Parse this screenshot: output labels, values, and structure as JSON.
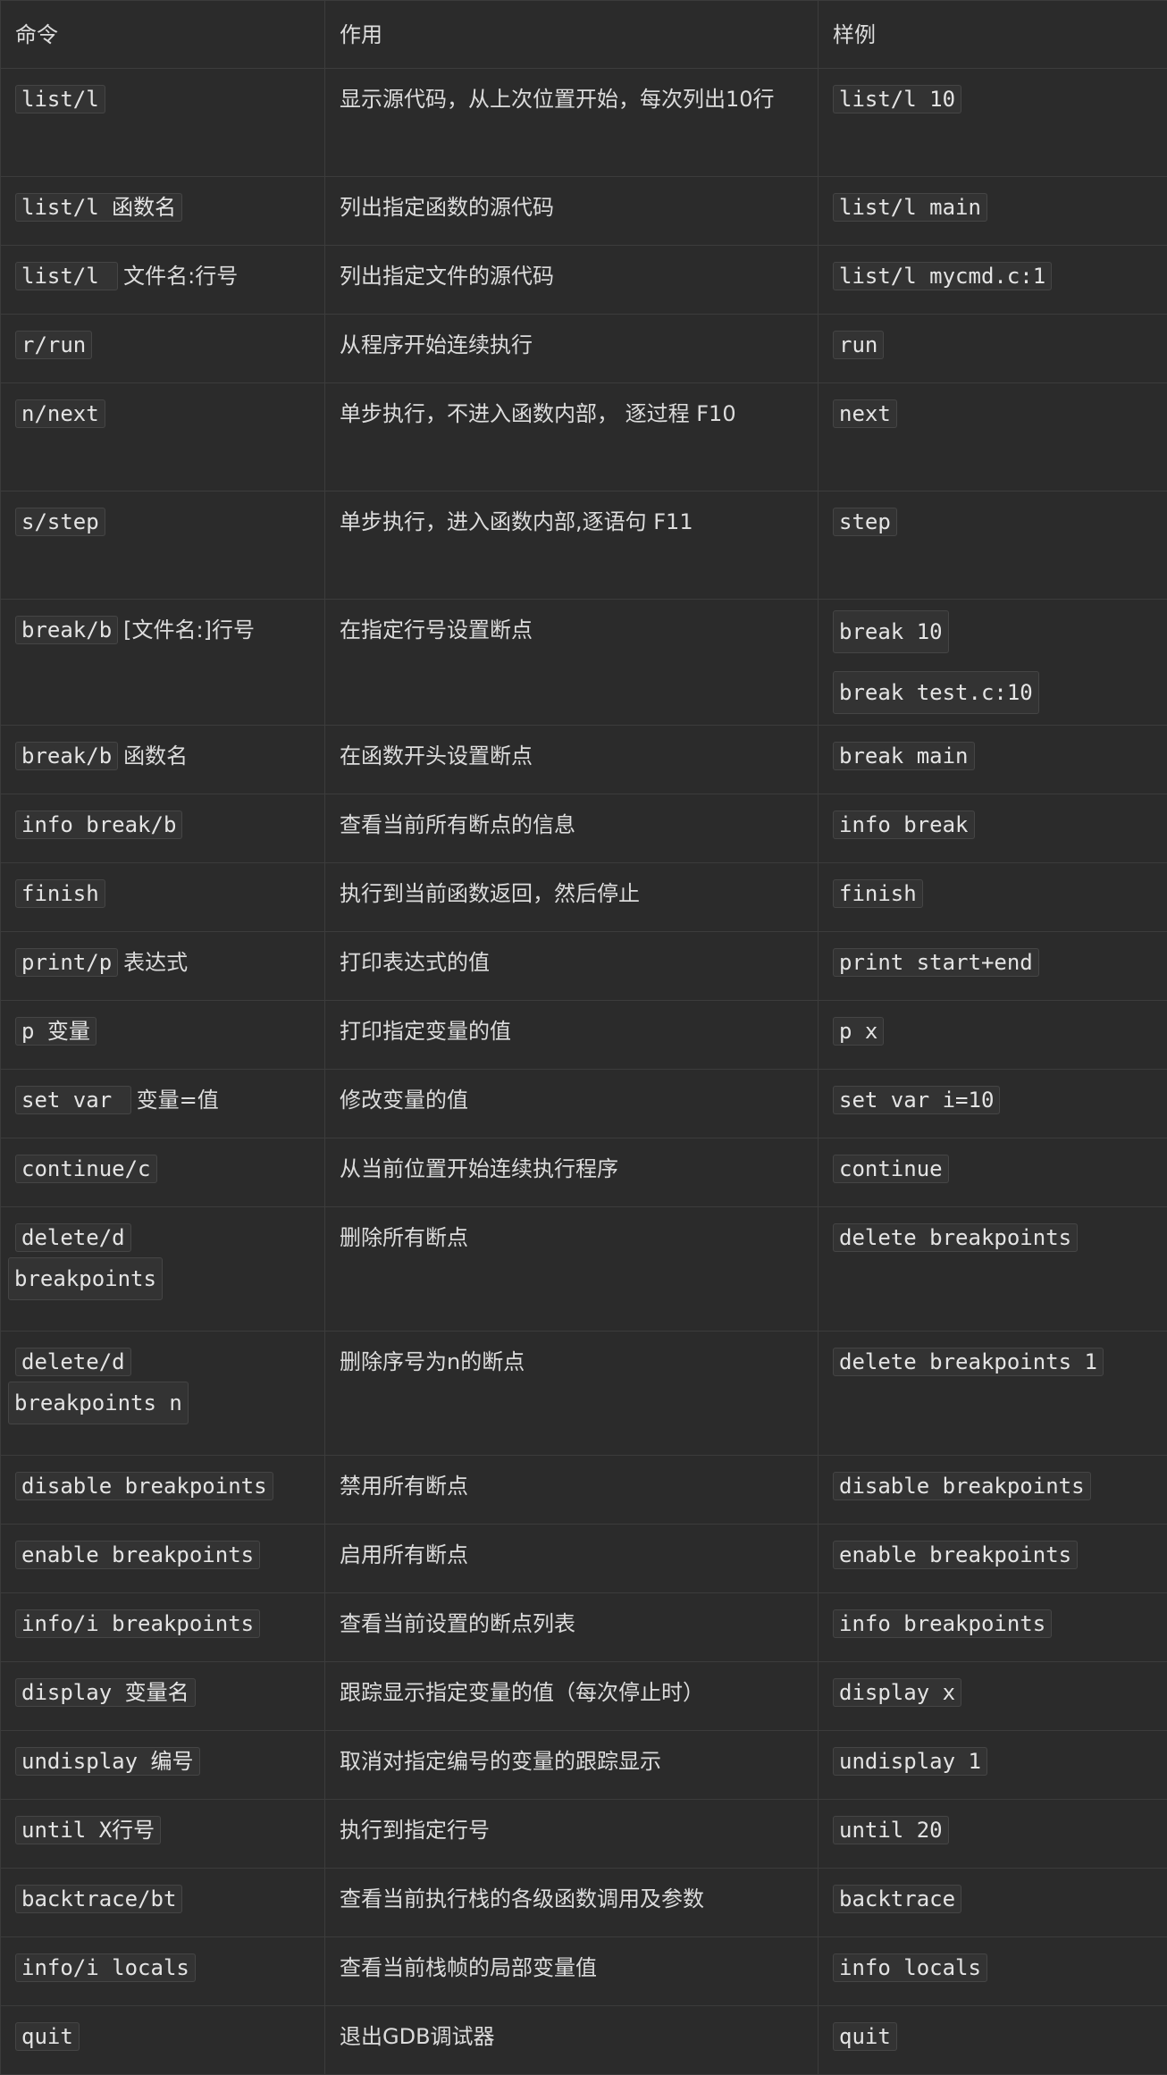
{
  "headers": [
    "命令",
    "作用",
    "样例"
  ],
  "rows": [
    {
      "cmd": "list/l",
      "cmd_suffix": "",
      "desc": "显示源代码，从上次位置开始，每次列出10行",
      "examples": [
        "list/l 10"
      ]
    },
    {
      "cmd": "list/l 函数名",
      "cmd_suffix": "",
      "desc": "列出指定函数的源代码",
      "examples": [
        "list/l main"
      ]
    },
    {
      "cmd": "list/l ",
      "cmd_suffix": "文件名:行号",
      "desc": "列出指定文件的源代码",
      "examples": [
        "list/l mycmd.c:1"
      ]
    },
    {
      "cmd": "r/run",
      "cmd_suffix": "",
      "desc": "从程序开始连续执行",
      "examples": [
        "run"
      ]
    },
    {
      "cmd": "n/next",
      "cmd_suffix": "",
      "desc": "单步执行，不进入函数内部， 逐过程 F10",
      "examples": [
        "next"
      ]
    },
    {
      "cmd": "s/step",
      "cmd_suffix": "",
      "desc": "单步执行，进入函数内部,逐语句 F11",
      "examples": [
        "step"
      ]
    },
    {
      "cmd": "break/b",
      "cmd_suffix": "[文件名:]行号",
      "desc": "在指定行号设置断点",
      "examples": [
        "break 10",
        "break test.c:10"
      ]
    },
    {
      "cmd": "break/b",
      "cmd_suffix": "函数名",
      "desc": "在函数开头设置断点",
      "examples": [
        "break main"
      ]
    },
    {
      "cmd": "info break/b",
      "cmd_suffix": "",
      "desc": "查看当前所有断点的信息",
      "examples": [
        "info break"
      ]
    },
    {
      "cmd": "finish",
      "cmd_suffix": "",
      "desc": "执行到当前函数返回，然后停止",
      "examples": [
        "finish"
      ]
    },
    {
      "cmd": "print/p",
      "cmd_suffix": "表达式",
      "desc": "打印表达式的值",
      "examples": [
        "print start+end"
      ]
    },
    {
      "cmd": "p 变量",
      "cmd_suffix": "",
      "desc": "打印指定变量的值",
      "examples": [
        "p x"
      ]
    },
    {
      "cmd": "set var ",
      "cmd_suffix": "变量=值",
      "desc": "修改变量的值",
      "examples": [
        "set var i=10"
      ]
    },
    {
      "cmd": "continue/c",
      "cmd_suffix": "",
      "desc": "从当前位置开始连续执行程序",
      "examples": [
        "continue"
      ]
    },
    {
      "cmd": "delete/d",
      "cmd_cont": "breakpoints",
      "cmd_suffix": "",
      "desc": "删除所有断点",
      "examples": [
        "delete breakpoints"
      ]
    },
    {
      "cmd": "delete/d",
      "cmd_cont": "breakpoints n",
      "cmd_suffix": "",
      "desc": "删除序号为n的断点",
      "examples": [
        "delete breakpoints 1"
      ]
    },
    {
      "cmd": "disable breakpoints",
      "cmd_suffix": "",
      "desc": "禁用所有断点",
      "examples": [
        "disable breakpoints"
      ]
    },
    {
      "cmd": "enable breakpoints",
      "cmd_suffix": "",
      "desc": "启用所有断点",
      "examples": [
        "enable breakpoints"
      ]
    },
    {
      "cmd": "info/i breakpoints",
      "cmd_suffix": "",
      "desc": "查看当前设置的断点列表",
      "examples": [
        "info breakpoints"
      ]
    },
    {
      "cmd": "display 变量名",
      "cmd_suffix": "",
      "desc": "跟踪显示指定变量的值（每次停止时）",
      "examples": [
        "display x"
      ]
    },
    {
      "cmd": "undisplay 编号",
      "cmd_suffix": "",
      "desc": "取消对指定编号的变量的跟踪显示",
      "examples": [
        "undisplay 1"
      ]
    },
    {
      "cmd": "until X行号",
      "cmd_suffix": "",
      "desc": "执行到指定行号",
      "examples": [
        "until 20"
      ]
    },
    {
      "cmd": "backtrace/bt",
      "cmd_suffix": "",
      "desc": "查看当前执行栈的各级函数调用及参数",
      "examples": [
        "backtrace"
      ]
    },
    {
      "cmd": "info/i locals",
      "cmd_suffix": "",
      "desc": "查看当前栈帧的局部变量值",
      "examples": [
        "info locals"
      ]
    },
    {
      "cmd": "quit",
      "cmd_suffix": "",
      "desc": "退出GDB调试器",
      "examples": [
        "quit"
      ]
    }
  ]
}
